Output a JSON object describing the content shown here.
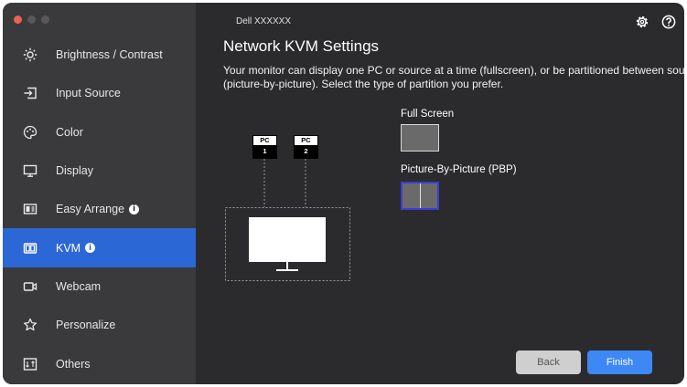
{
  "window": {
    "model": "Dell XXXXXX"
  },
  "sidebar": {
    "items": [
      {
        "label": "Brightness / Contrast",
        "icon": "brightness-icon",
        "info": false,
        "active": false
      },
      {
        "label": "Input Source",
        "icon": "input-source-icon",
        "info": false,
        "active": false
      },
      {
        "label": "Color",
        "icon": "color-palette-icon",
        "info": false,
        "active": false
      },
      {
        "label": "Display",
        "icon": "display-icon",
        "info": false,
        "active": false
      },
      {
        "label": "Easy Arrange",
        "icon": "easy-arrange-icon",
        "info": true,
        "active": false
      },
      {
        "label": "KVM",
        "icon": "kvm-icon",
        "info": true,
        "active": true
      },
      {
        "label": "Webcam",
        "icon": "webcam-icon",
        "info": false,
        "active": false
      },
      {
        "label": "Personalize",
        "icon": "star-icon",
        "info": false,
        "active": false
      },
      {
        "label": "Others",
        "icon": "others-icon",
        "info": false,
        "active": false
      }
    ],
    "info_glyph": "i"
  },
  "header": {
    "settings_icon": "gear-icon",
    "help_icon": "help-icon"
  },
  "main": {
    "title": "Network KVM Settings",
    "description_line1": "Your monitor can display one PC or source at a time (fullscreen), or be partitioned between sources",
    "description_line2": "(picture-by-picture). Select the type of partition you prefer.",
    "diagram": {
      "pc1_top": "PC",
      "pc1_num": "1",
      "pc2_top": "PC",
      "pc2_num": "2"
    },
    "options": {
      "full_screen": "Full Screen",
      "pbp": "Picture-By-Picture (PBP)",
      "selected": "pbp"
    },
    "buttons": {
      "back": "Back",
      "finish": "Finish"
    }
  },
  "colors": {
    "accent": "#2c67d6",
    "finish": "#3e88f5",
    "selected_border": "#3b3bd8"
  }
}
